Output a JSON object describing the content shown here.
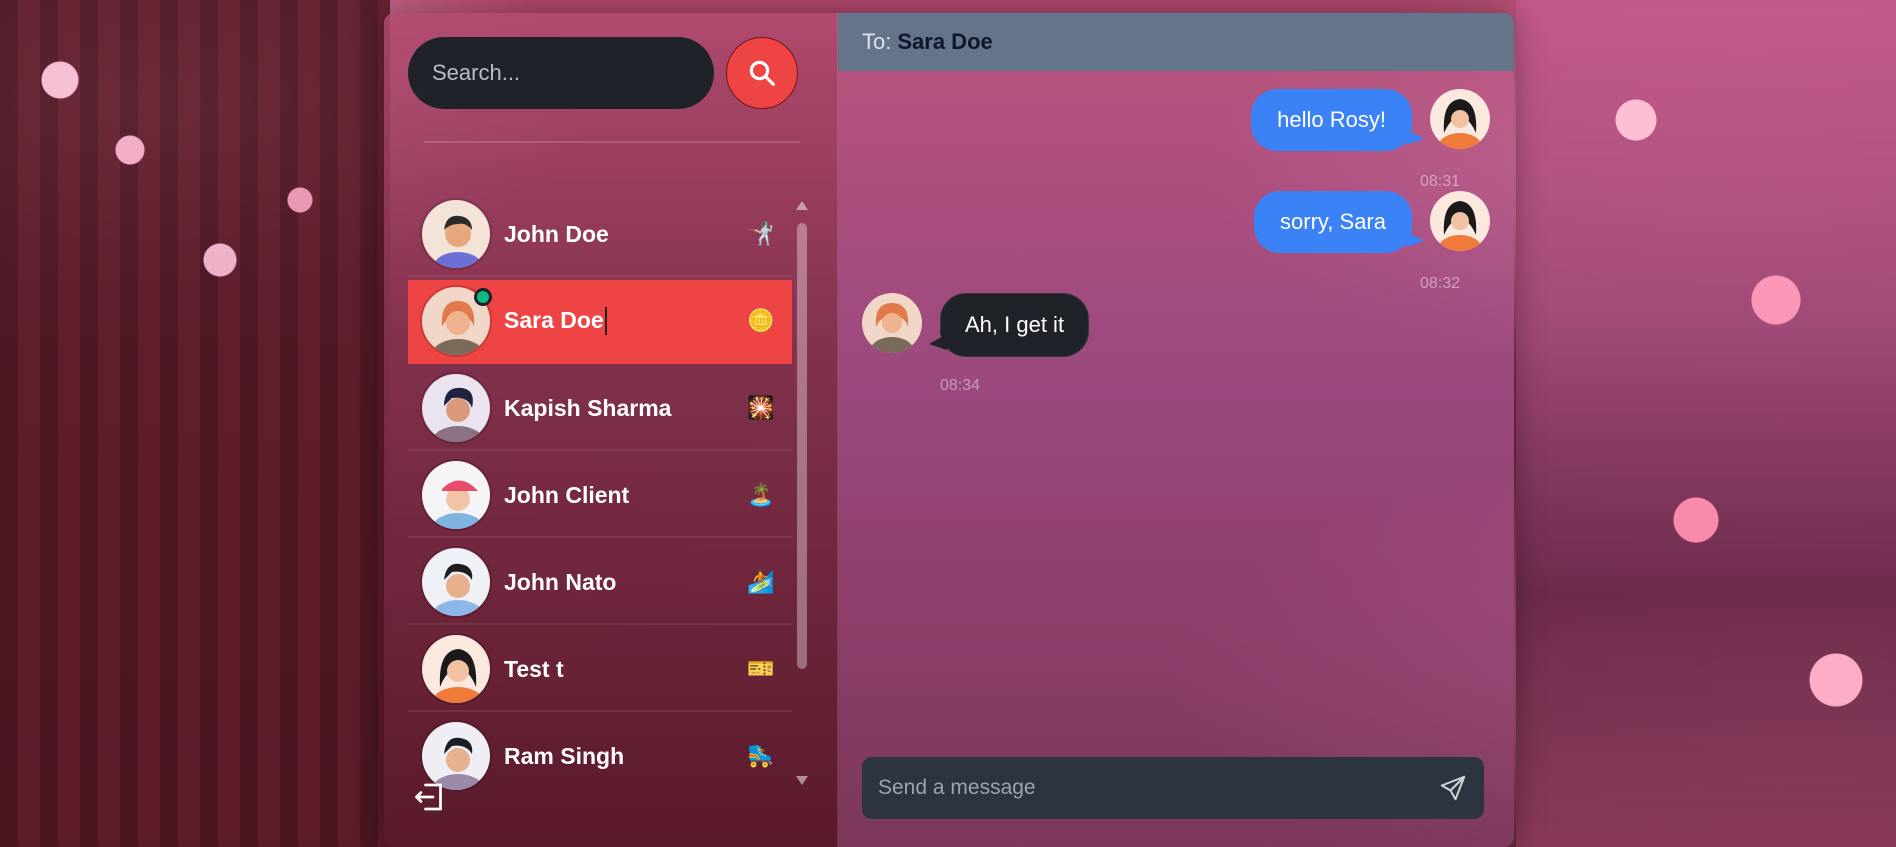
{
  "search": {
    "placeholder": "Search..."
  },
  "contacts": [
    {
      "name": "John Doe",
      "status_emoji": "🤺",
      "active": false
    },
    {
      "name": "Sara Doe",
      "status_emoji": "🪙",
      "active": true,
      "online": true
    },
    {
      "name": "Kapish Sharma",
      "status_emoji": "🎇",
      "active": false
    },
    {
      "name": "John Client",
      "status_emoji": "🏝️",
      "active": false
    },
    {
      "name": "John Nato",
      "status_emoji": "🏄",
      "active": false
    },
    {
      "name": "Test t",
      "status_emoji": "🎫",
      "active": false
    },
    {
      "name": "Ram Singh",
      "status_emoji": "🛼",
      "active": false
    }
  ],
  "chat": {
    "to_label": "To:",
    "to_name": "Sara Doe",
    "messages": [
      {
        "direction": "out",
        "text": "hello Rosy!",
        "time": "08:31"
      },
      {
        "direction": "out",
        "text": "sorry, Sara",
        "time": "08:32"
      },
      {
        "direction": "in",
        "text": "Ah, I get it",
        "time": "08:34"
      }
    ],
    "composer_placeholder": "Send a message"
  },
  "colors": {
    "accent": "#ef4444",
    "bubble_out": "#3b82f6",
    "bubble_in": "#1f2329",
    "header": "#64748b",
    "online": "#10b981"
  },
  "icons": {
    "search": "search-icon",
    "send": "send-icon",
    "logout": "logout-icon"
  }
}
